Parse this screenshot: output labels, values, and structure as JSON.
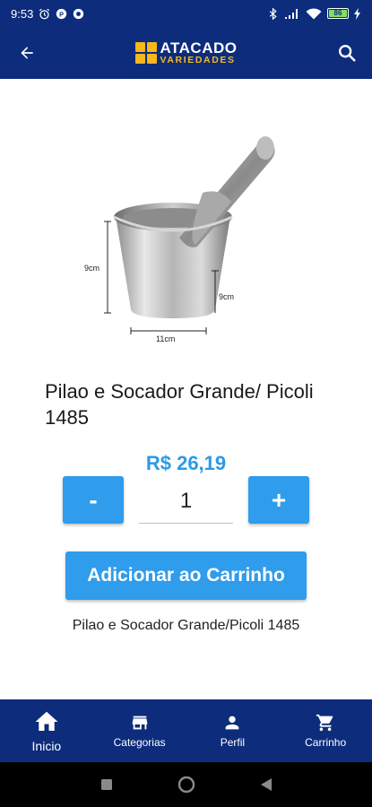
{
  "status_bar": {
    "time": "9:53",
    "battery": "86"
  },
  "header": {
    "logo_line1": "ATACADO",
    "logo_line2": "VARIEDADES"
  },
  "product_image": {
    "dim_height": "9cm",
    "dim_side": "9cm",
    "dim_width": "11cm"
  },
  "product": {
    "title": "Pilao e Socador Grande/ Picoli 1485",
    "price": "R$ 26,19",
    "quantity": "1",
    "minus_label": "-",
    "plus_label": "+",
    "add_to_cart_label": "Adicionar ao Carrinho",
    "description": "Pilao e Socador Grande/Picoli 1485"
  },
  "bottom_nav": {
    "items": [
      {
        "label": "Inicio",
        "icon": "home-icon"
      },
      {
        "label": "Categorias",
        "icon": "store-icon"
      },
      {
        "label": "Perfil",
        "icon": "person-icon"
      },
      {
        "label": "Carrinho",
        "icon": "cart-icon"
      }
    ]
  },
  "colors": {
    "primary_dark": "#0d2c7c",
    "accent_blue": "#2f9cec",
    "price_blue": "#2b9ae8",
    "logo_yellow": "#f6b81b"
  }
}
